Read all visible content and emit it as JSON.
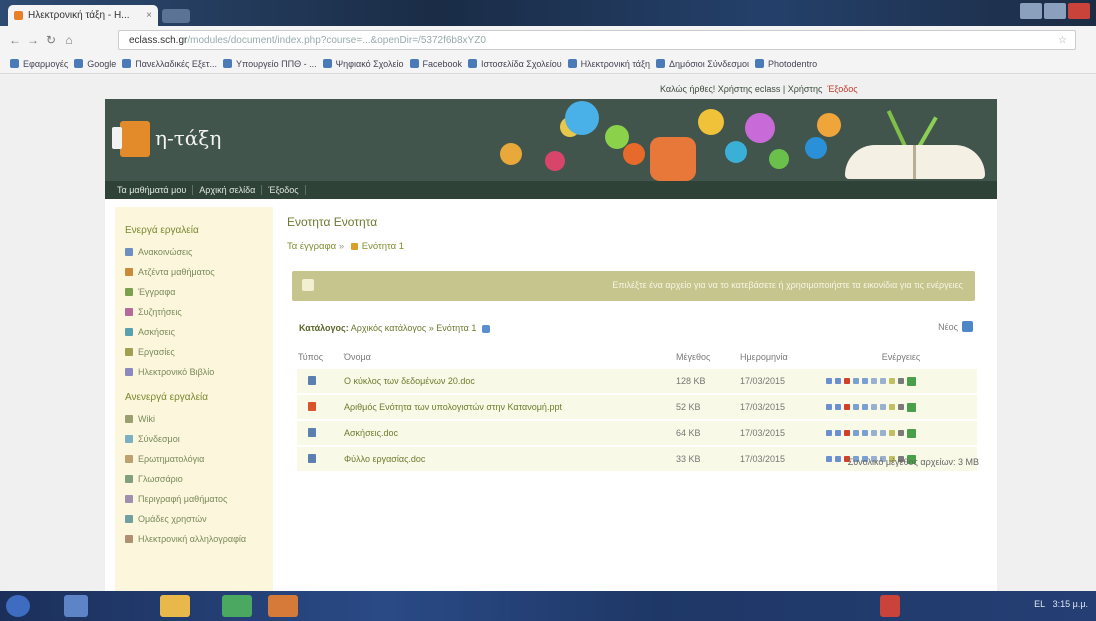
{
  "browser": {
    "tab_title": "Ηλεκτρονική τάξη - Η...",
    "url_host": "eclass.sch.gr",
    "url_rest": "/modules/document/index.php?course=...&openDir=/5372f6b8xYZ0",
    "bookmarks": [
      "Εφαρμογές",
      "Google",
      "Πανελλαδικές Εξετ...",
      "Υπουργείο ΠΠΘ - ...",
      "Ψηφιακό Σχολείο",
      "Facebook",
      "Ιστοσελίδα Σχολείου",
      "Ηλεκτρονική τάξη",
      "Δημόσιοι Σύνδεσμοι",
      "Photodentro"
    ]
  },
  "page": {
    "userbar": "Καλώς ήρθες! Χρήστης eclass | Χρήστης",
    "logout": "Έξοδος",
    "logo_text": "η-τάξη",
    "mainnav": [
      "Τα μαθήματά μου",
      "Αρχική σελίδα",
      "Έξοδος"
    ]
  },
  "sidebar": {
    "heading_1": "Ενεργά εργαλεία",
    "items_1": [
      "Ανακοινώσεις",
      "Ατζέντα μαθήματος",
      "Έγγραφα",
      "Συζητήσεις",
      "Ασκήσεις",
      "Εργασίες",
      "Ηλεκτρονικό Βιβλίο"
    ],
    "heading_2": "Ανενεργά εργαλεία",
    "items_2": [
      "Wiki",
      "Σύνδεσμοι",
      "Ερωτηματολόγια",
      "Γλωσσάριο",
      "Περιγραφή μαθήματος",
      "Ομάδες χρηστών",
      "Ηλεκτρονική αλληλογραφία"
    ]
  },
  "content": {
    "title": "Ενοτητα Ενοτητα",
    "crumbs_root": "Τα έγγραφα",
    "crumbs_current": "Ενότητα 1",
    "notice": "Επιλέξτε ένα αρχείο για να το κατεβάσετε ή χρησιμοποιήστε τα εικονίδια για τις ενέργειες",
    "path_label": "Κατάλογος:",
    "path_value": "Αρχικός κατάλογος » Ενότητα 1",
    "new_label": "Νέος",
    "columns": [
      "Τύπος",
      "Όνομα",
      "Μέγεθος",
      "Ημερομηνία",
      "Ενέργειες"
    ],
    "rows": [
      {
        "name": "Ο κύκλος των δεδομένων 20.doc",
        "size": "128 KB",
        "date": "17/03/2015"
      },
      {
        "name": "Αριθμός Ενότητα των υπολογιστών στην Κατανομή.ppt",
        "size": "52 KB",
        "date": "17/03/2015"
      },
      {
        "name": "Ασκήσεις.doc",
        "size": "64 KB",
        "date": "17/03/2015"
      },
      {
        "name": "Φύλλο εργασίας.doc",
        "size": "33 KB",
        "date": "17/03/2015"
      }
    ],
    "total": "Συνολικό μέγεθος αρχείων: 3 MB"
  },
  "taskbar": {
    "clock": "3:15 μ.μ.",
    "lang": "EL"
  }
}
